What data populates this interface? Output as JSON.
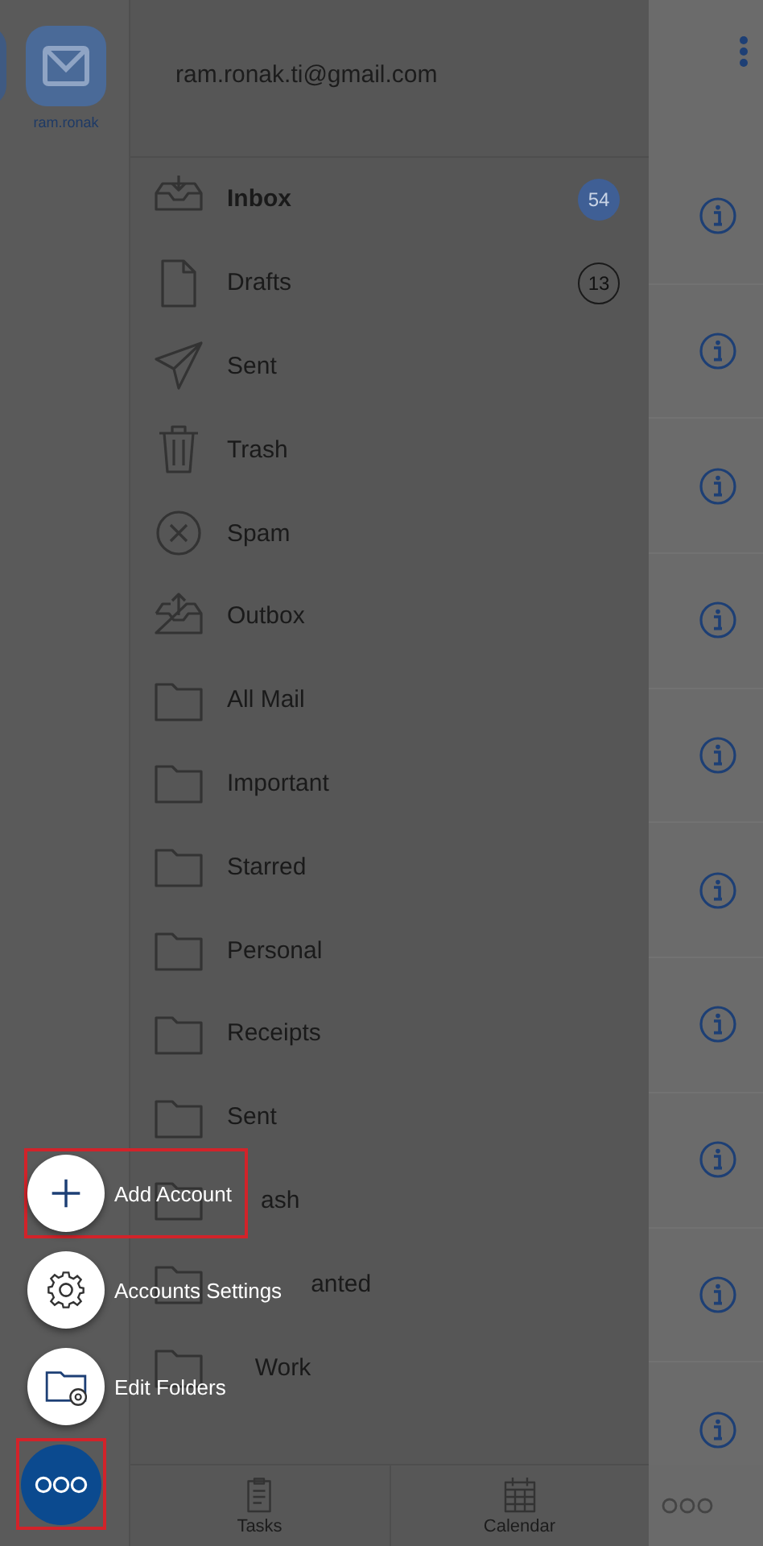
{
  "account_rail": {
    "accounts": [
      {
        "selected": false
      },
      {
        "label": "ram.ronak",
        "selected": true
      }
    ]
  },
  "drawer": {
    "email": "ram.ronak.ti@gmail.com",
    "folders": [
      {
        "name": "Inbox",
        "kind": "inbox",
        "selected": true,
        "badge": "54",
        "filled": true
      },
      {
        "name": "Drafts",
        "kind": "drafts",
        "selected": false,
        "badge": "13",
        "filled": false
      },
      {
        "name": "Sent",
        "kind": "sent",
        "selected": false
      },
      {
        "name": "Trash",
        "kind": "trash",
        "selected": false
      },
      {
        "name": "Spam",
        "kind": "spam",
        "selected": false
      },
      {
        "name": "Outbox",
        "kind": "outbox",
        "selected": false
      },
      {
        "name": "All Mail",
        "kind": "folder",
        "selected": false
      },
      {
        "name": "Important",
        "kind": "folder",
        "selected": false
      },
      {
        "name": "Starred",
        "kind": "folder",
        "selected": false
      },
      {
        "name": "Personal",
        "kind": "folder",
        "selected": false
      },
      {
        "name": "Receipts",
        "kind": "folder",
        "selected": false
      },
      {
        "name": "Sent",
        "kind": "folder",
        "selected": false
      },
      {
        "name": "ash",
        "kind": "folder",
        "selected": false
      },
      {
        "name": "anted",
        "kind": "folder",
        "selected": false
      },
      {
        "name": "Work",
        "kind": "folder",
        "selected": false
      }
    ],
    "bottom_tabs": [
      {
        "label": "Tasks",
        "kind": "tasks"
      },
      {
        "label": "Calendar",
        "kind": "calendar"
      }
    ]
  },
  "message_pane": {
    "rows": [
      {
        "kind": "info"
      },
      {
        "kind": "info"
      },
      {
        "kind": "info"
      },
      {
        "kind": "info"
      },
      {
        "kind": "info"
      },
      {
        "kind": "info"
      },
      {
        "kind": "info"
      },
      {
        "kind": "info"
      },
      {
        "kind": "info"
      },
      {
        "kind": "info"
      }
    ]
  },
  "speed_dial": {
    "actions": [
      {
        "label": "Add Account",
        "kind": "add",
        "highlighted": true
      },
      {
        "label": "Accounts Settings",
        "kind": "settings",
        "highlighted": false
      },
      {
        "label": "Edit Folders",
        "kind": "folders",
        "highlighted": false
      }
    ],
    "fab": {
      "highlighted": true
    }
  }
}
